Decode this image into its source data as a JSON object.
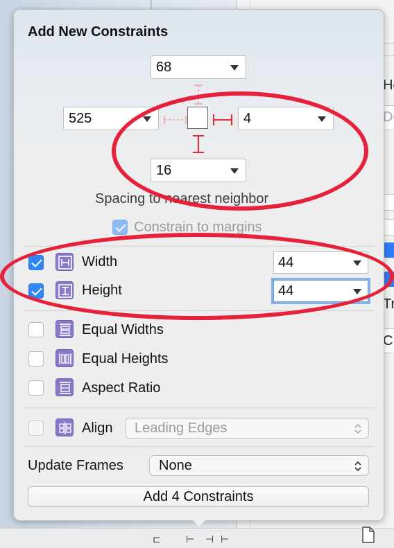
{
  "popover": {
    "title": "Add New Constraints",
    "spacing": {
      "top": "68",
      "left": "525",
      "right": "4",
      "bottom": "16",
      "label": "Spacing to nearest neighbor"
    },
    "constrain_to_margins": {
      "label": "Constrain to margins",
      "checked": true
    },
    "rows": {
      "width": {
        "label": "Width",
        "value": "44",
        "checked": true
      },
      "height": {
        "label": "Height",
        "value": "44",
        "checked": true
      },
      "equal_widths": {
        "label": "Equal Widths",
        "checked": false
      },
      "equal_heights": {
        "label": "Equal Heights",
        "checked": false
      },
      "aspect_ratio": {
        "label": "Aspect Ratio",
        "checked": false
      },
      "align": {
        "label": "Align",
        "value": "Leading Edges",
        "checked": false
      }
    },
    "update_frames": {
      "label": "Update Frames",
      "value": "None"
    },
    "add_button": "Add 4 Constraints"
  },
  "background": {
    "frag_he": "He",
    "frag_de": "De",
    "frag_tr": "Tr",
    "frag_c": "C"
  },
  "colors": {
    "accent": "#2f86f6",
    "annotation": "#e5213b",
    "icon_purple": "#8a79c8"
  }
}
